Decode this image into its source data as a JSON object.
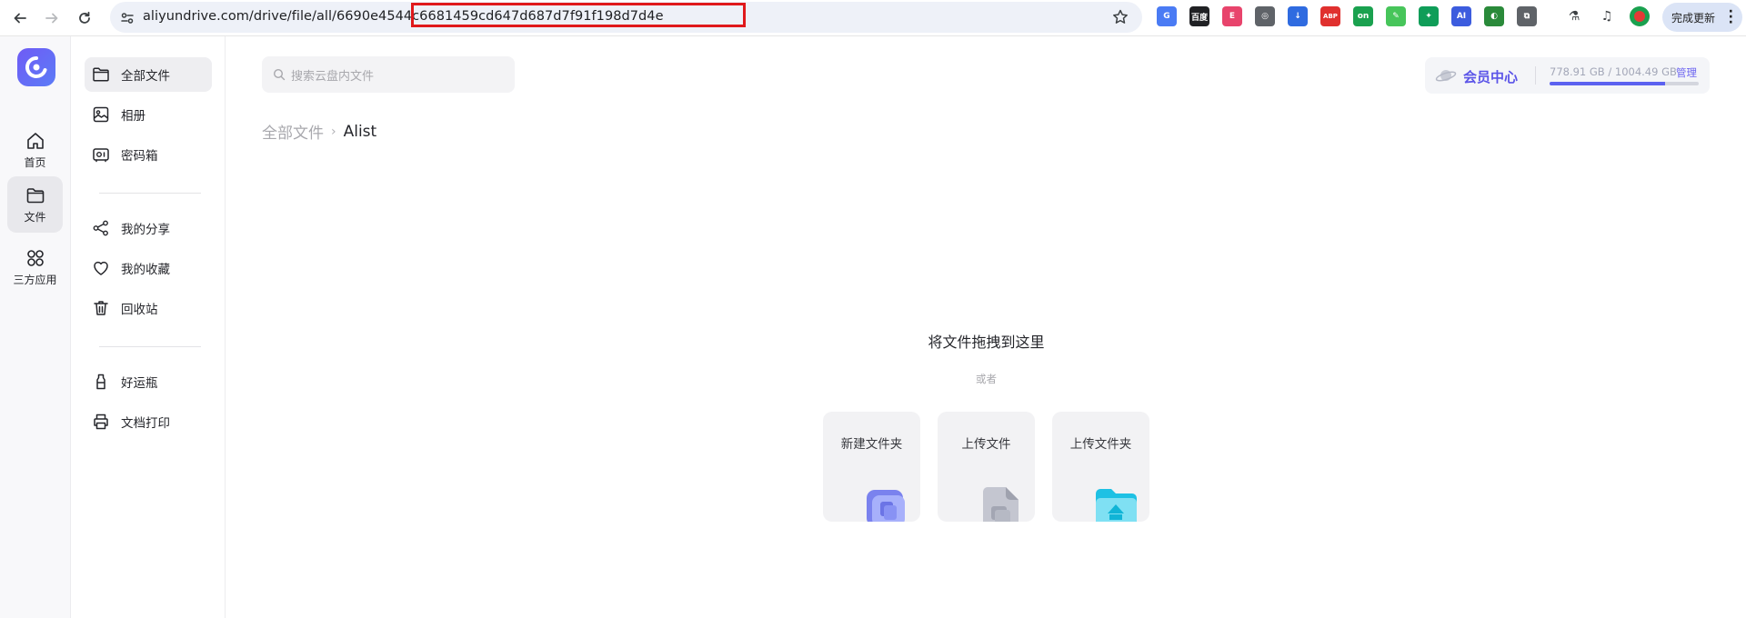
{
  "browser": {
    "url": "aliyundrive.com/drive/file/all/6690e4544c6681459cd647d687d7f91f198d7d4e",
    "update_button_label": "完成更新",
    "extensions": [
      {
        "name": "google-translate-icon",
        "color": "#4a7bf4",
        "glyph": "G"
      },
      {
        "name": "baidu-icon",
        "color": "#202124",
        "glyph": "百度"
      },
      {
        "name": "pink-ext-icon",
        "color": "#e8446c",
        "glyph": "E"
      },
      {
        "name": "shield-ext-icon",
        "color": "#5f6368",
        "glyph": "◎"
      },
      {
        "name": "download-ext-icon",
        "color": "#2f6be0",
        "glyph": "↓"
      },
      {
        "name": "adblock-plus-icon",
        "color": "#e0302e",
        "glyph": "ABP"
      },
      {
        "name": "green-on-ext-icon",
        "color": "#1aa14f",
        "glyph": "on"
      },
      {
        "name": "leaf-ext-icon",
        "color": "#47c55a",
        "glyph": "✎"
      },
      {
        "name": "puzzle-green-icon",
        "color": "#0f9d58",
        "glyph": "✦"
      },
      {
        "name": "ai-ext-icon",
        "color": "#3c5cde",
        "glyph": "AI"
      },
      {
        "name": "globe-ext-icon",
        "color": "#2a8a3a",
        "glyph": "◐"
      },
      {
        "name": "extensions-puzzle-icon",
        "color": "#5f6368",
        "glyph": "⧉"
      }
    ]
  },
  "rail": {
    "items": [
      {
        "label": "首页"
      },
      {
        "label": "文件"
      },
      {
        "label": "三方应用"
      }
    ]
  },
  "sidebar": {
    "items": [
      {
        "label": "全部文件"
      },
      {
        "label": "相册"
      },
      {
        "label": "密码箱"
      },
      {
        "label": "我的分享"
      },
      {
        "label": "我的收藏"
      },
      {
        "label": "回收站"
      },
      {
        "label": "好运瓶"
      },
      {
        "label": "文档打印"
      }
    ]
  },
  "main": {
    "search_placeholder": "搜索云盘内文件",
    "breadcrumb": {
      "root": "全部文件",
      "separator": "›",
      "current": "Alist"
    },
    "member": {
      "label": "会员中心",
      "storage": "778.91 GB / 1004.49 GB",
      "manage": "管理",
      "used_fraction": 0.775
    },
    "drop_title": "将文件拖拽到这里",
    "or": "或者",
    "actions": [
      {
        "label": "新建文件夹"
      },
      {
        "label": "上传文件"
      },
      {
        "label": "上传文件夹"
      }
    ]
  }
}
